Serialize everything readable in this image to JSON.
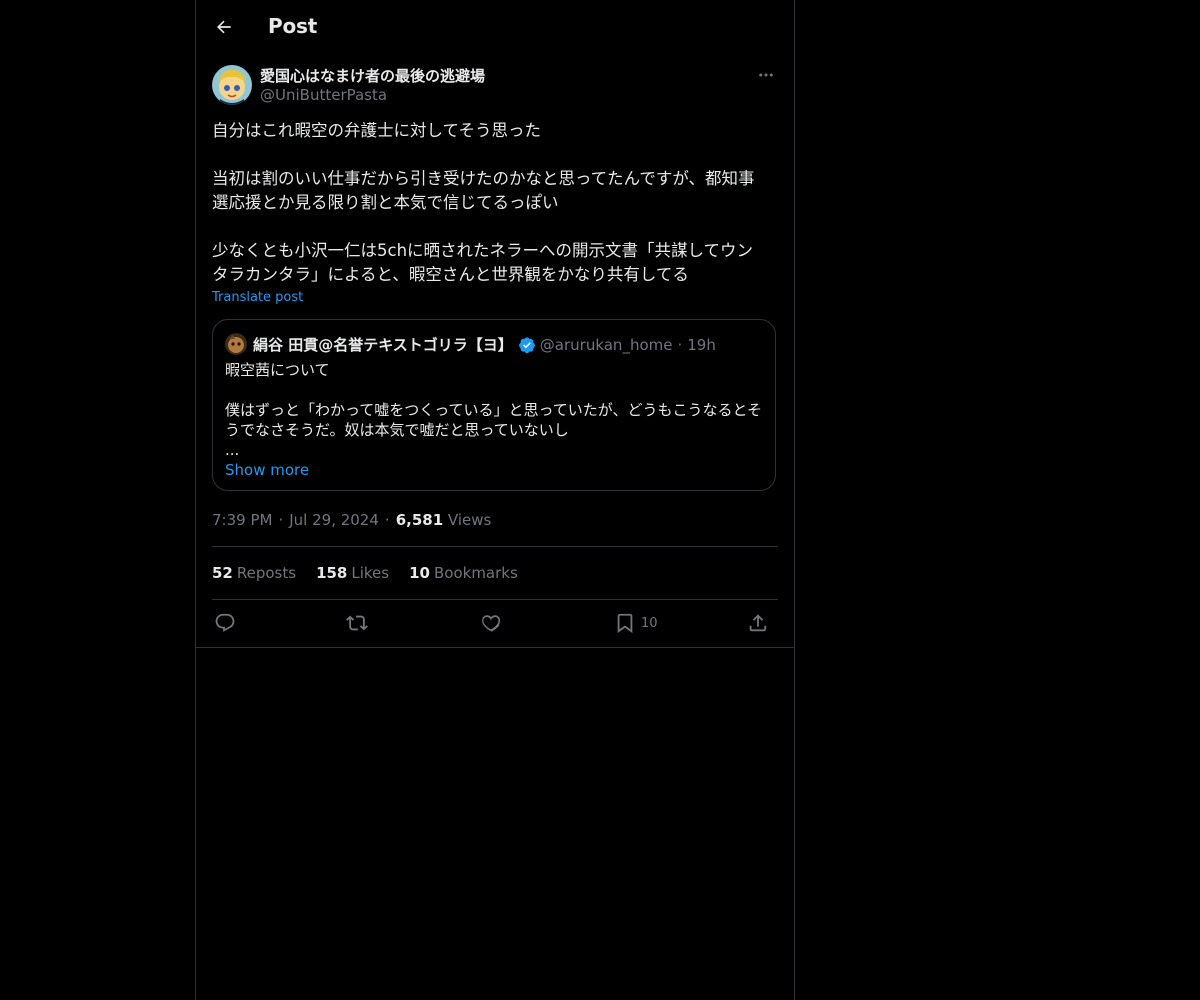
{
  "header": {
    "title": "Post"
  },
  "author": {
    "name": "愛国心はなまけ者の最後の逃避場",
    "handle": "@UniButterPasta"
  },
  "post": {
    "paragraphs": [
      "自分はこれ暇空の弁護士に対してそう思った",
      "当初は割のいい仕事だから引き受けたのかなと思ってたんですが、都知事\n選応援とか見る限り割と本気で信じてるっぽい",
      "少なくとも小沢一仁は5chに晒されたネラーへの開示文書「共謀してウン\nタラカンタラ」によると、暇空さんと世界観をかなり共有してる"
    ],
    "translate_label": "Translate post"
  },
  "quote": {
    "name": "絹谷 田貫@名誉テキストゴリラ【ヨ】",
    "handle": "@arurukan_home",
    "dot": "·",
    "time": "19h",
    "paragraphs": [
      "暇空茜について",
      "僕はずっと「わかって嘘をつくっている」と思っていたが、どうもこうなるとそ\nうでなさそうだ。奴は本気で嘘だと思っていないし\n..."
    ],
    "show_more": "Show more"
  },
  "meta": {
    "time": "7:39 PM",
    "dot": "·",
    "date": "Jul 29, 2024",
    "views_count": "6,581",
    "views_label": "Views"
  },
  "stats": {
    "reposts_count": "52",
    "reposts_label": "Reposts",
    "likes_count": "158",
    "likes_label": "Likes",
    "bookmarks_count": "10",
    "bookmarks_label": "Bookmarks"
  },
  "actions": {
    "bookmark_count": "10"
  },
  "colors": {
    "background": "#000000",
    "text": "#e7e9ea",
    "secondary": "#71767b",
    "accent": "#1d9bf0",
    "border": "#2f3336"
  },
  "icons": {
    "back": "arrow-left-icon",
    "more": "more-horizontal-icon",
    "verified": "verified-badge-icon",
    "reply": "reply-icon",
    "repost": "repost-icon",
    "like": "heart-icon",
    "bookmark": "bookmark-icon",
    "share": "share-icon"
  }
}
